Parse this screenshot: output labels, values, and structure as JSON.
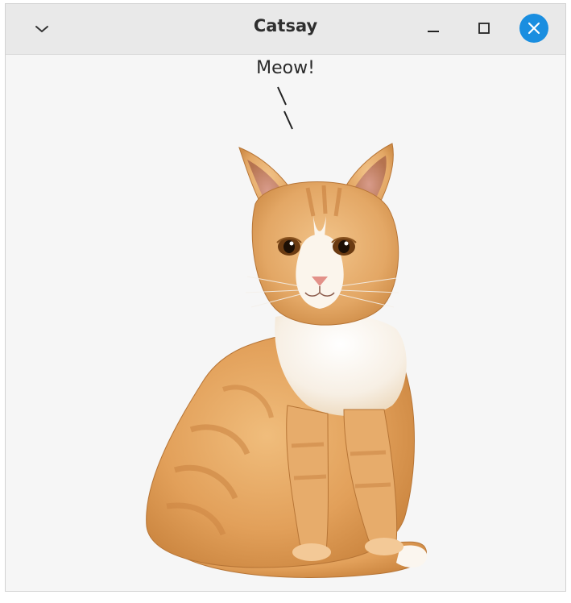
{
  "window": {
    "title": "Catsay",
    "menu_icon": "chevron-down-icon",
    "minimize_icon": "minimize-icon",
    "maximize_icon": "maximize-icon",
    "close_icon": "close-icon"
  },
  "speech": {
    "text": "Meow!",
    "tail": "\\ \\"
  },
  "image": {
    "subject": "cat-image"
  },
  "colors": {
    "titlebar": "#e9e9e9",
    "window_bg": "#f6f6f6",
    "close_button": "#1a8ee0",
    "title_text": "#2e2e2e"
  }
}
